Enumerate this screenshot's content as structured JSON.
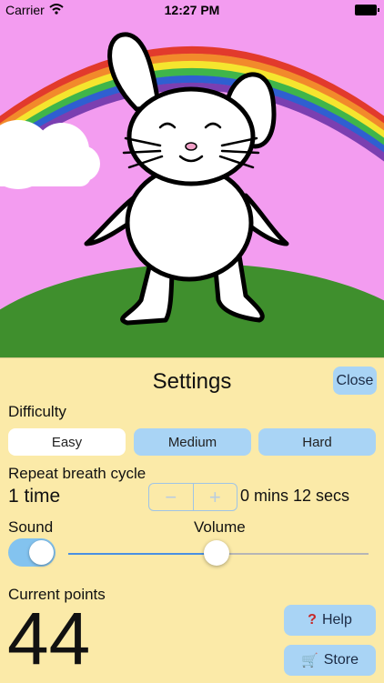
{
  "status_bar": {
    "carrier": "Carrier",
    "time": "12:27 PM"
  },
  "settings": {
    "title": "Settings",
    "close_label": "Close",
    "difficulty": {
      "label": "Difficulty",
      "options": [
        "Easy",
        "Medium",
        "Hard"
      ],
      "selected": "Easy"
    },
    "breath_cycle": {
      "label": "Repeat breath cycle",
      "value": "1 time",
      "stepper_minus": "−",
      "stepper_plus": "+",
      "duration": "0 mins 12 secs"
    },
    "sound": {
      "label": "Sound",
      "enabled": true
    },
    "volume": {
      "label": "Volume",
      "level": 0.49
    },
    "points": {
      "label": "Current points",
      "value": "44"
    },
    "help_label": "Help",
    "store_label": "Store"
  },
  "colors": {
    "sky": "#f39cf0",
    "panel": "#fbeaa8",
    "button": "#a9d4f5",
    "hill": "#3f8f2d",
    "accent": "#4a90e2"
  },
  "icons": {
    "wifi": "wifi-icon",
    "battery": "battery-icon",
    "help": "question-mark-icon",
    "store": "shopping-cart-icon"
  }
}
